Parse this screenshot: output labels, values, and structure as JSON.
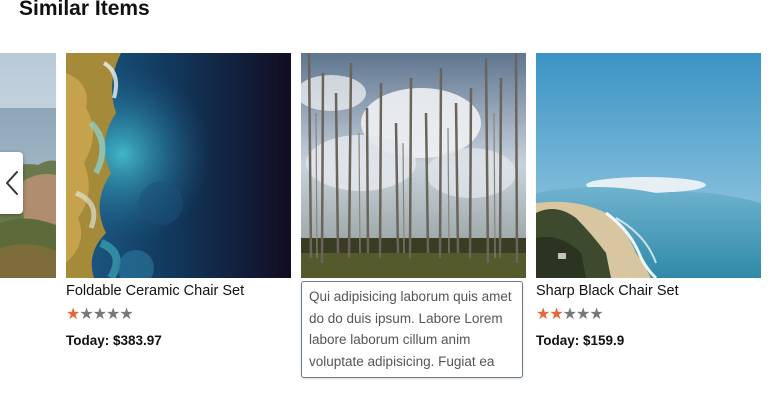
{
  "section": {
    "title": "Similar Items"
  },
  "carousel": {
    "prev_icon": "chevron-left-icon",
    "items": [
      {
        "image": "coastal-hillside-photo",
        "title": "",
        "price": ""
      },
      {
        "image": "aerial-ocean-coast-photo",
        "title": "Foldable Ceramic Chair Set",
        "rating": 1,
        "rating_max": 5,
        "price": "Today: $383.97"
      },
      {
        "image": "dead-forest-clouds-photo",
        "description": "Qui adipisicing laborum quis amet do do duis ipsum. Labore Lorem labore laborum cillum anim voluptate adipisicing. Fugiat ea"
      },
      {
        "image": "beach-coastline-aerial-photo",
        "title": "Sharp Black Chair Set",
        "rating": 2,
        "rating_max": 5,
        "price": "Today: $159.9"
      }
    ]
  },
  "colors": {
    "star_filled": "#e5673a",
    "star_empty": "#777777",
    "tooltip_border": "#6b7a89"
  }
}
